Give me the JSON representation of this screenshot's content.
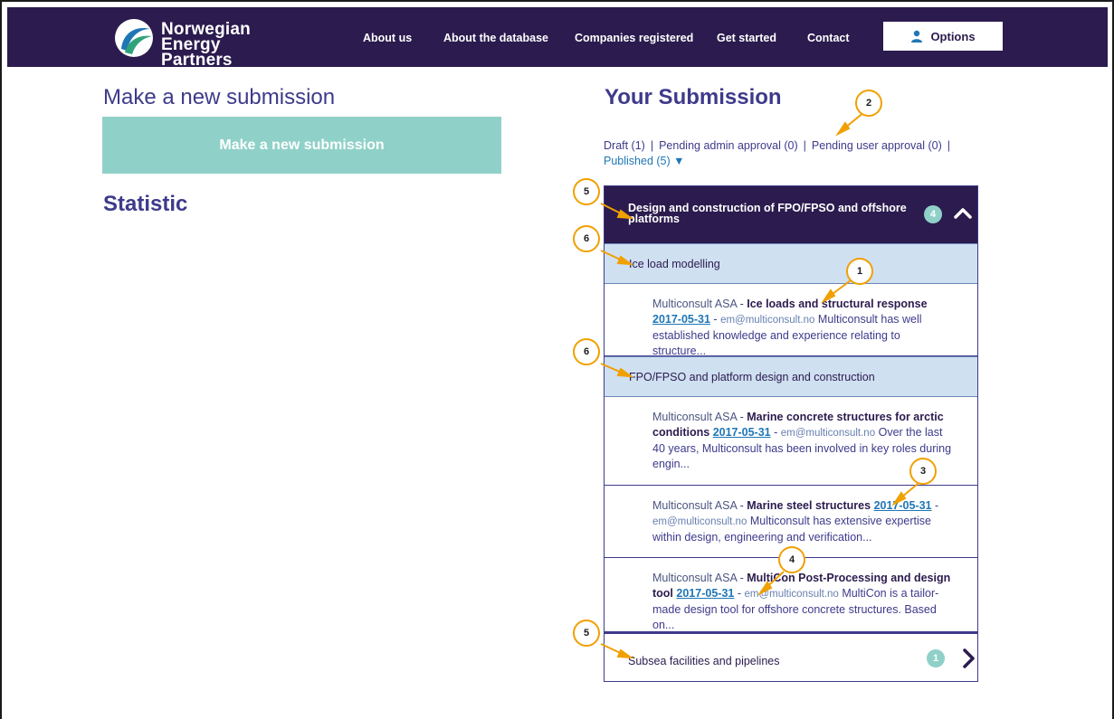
{
  "nav": {
    "logo_line1": "Norwegian",
    "logo_line2": "Energy Partners",
    "links": [
      "About us",
      "About the database",
      "Companies registered",
      "Get started",
      "Contact"
    ],
    "options_label": "Options"
  },
  "left": {
    "heading": "Make a new submission",
    "button_label": "Make a new submission",
    "statistic_heading": "Statistic"
  },
  "right": {
    "heading": "Your Submission",
    "filters": {
      "draft": "Draft (1)",
      "pending_admin": "Pending admin approval (0)",
      "pending_user": "Pending user approval (0)",
      "published": "Published (5) ▼",
      "separator": "|"
    },
    "category1": {
      "title": "Design and construction of FPO/FPSO and offshore platforms",
      "count": "4"
    },
    "subcategory1": "Ice load modelling",
    "subcategory2": "FPO/FPSO and platform design and construction",
    "items": [
      {
        "company": "Multiconsult ASA",
        "dash": " - ",
        "title": "Ice loads and structural response",
        "date": "2017-05-31",
        "email": "em@multiconsult.no",
        "desc": "Multiconsult has well established knowledge and experience relating to structure..."
      },
      {
        "company": "Multiconsult ASA",
        "dash": " - ",
        "title": "Marine concrete structures for arctic conditions",
        "date": "2017-05-31",
        "email": "em@multiconsult.no",
        "desc": "Over the last 40 years, Multiconsult has been involved in key roles during engin..."
      },
      {
        "company": "Multiconsult ASA",
        "dash": " - ",
        "title": "Marine steel structures",
        "date": "2017-05-31",
        "email": "em@multiconsult.no",
        "desc": "Multiconsult has extensive expertise within design, engineering and verification..."
      },
      {
        "company": "Multiconsult ASA",
        "dash": " - ",
        "title": "MultiCon Post-Processing and design tool",
        "date": "2017-05-31",
        "email": "em@multiconsult.no",
        "desc": "MultiCon is a tailor-made design tool for offshore concrete structures. Based on..."
      }
    ],
    "category2": {
      "title": "Subsea facilities and pipelines",
      "count": "1"
    }
  },
  "callouts": [
    "1",
    "2",
    "3",
    "4",
    "5",
    "5",
    "6",
    "6"
  ],
  "colors": {
    "nav_bg": "#2b1b4e",
    "accent_teal": "#8fd1c8",
    "heading_purple": "#3e3a8b",
    "subcategory_bg": "#cfe0f1",
    "link_blue": "#1f76b6",
    "callout_orange": "#f0a000"
  }
}
